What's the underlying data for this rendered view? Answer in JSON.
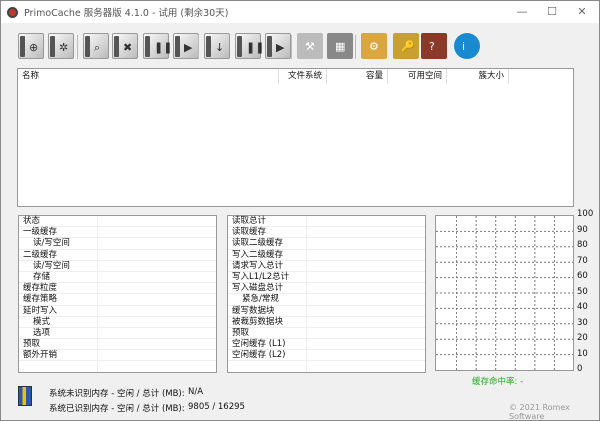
{
  "window": {
    "title": "PrimoCache 服务器版 4.1.0 - 试用 (剩余30天)",
    "minimize": "—",
    "maximize": "☐",
    "close": "✕"
  },
  "toolbar": [
    {
      "name": "new-cache-task",
      "glyph": "⊕"
    },
    {
      "name": "cache-options",
      "glyph": "✲"
    },
    {
      "name": "view-details",
      "glyph": "⌕"
    },
    {
      "name": "delete-task",
      "glyph": "✖"
    },
    {
      "name": "pause-task",
      "glyph": "❚❚"
    },
    {
      "name": "resume-task",
      "glyph": "▶"
    },
    {
      "name": "flush-deferred",
      "glyph": "↓"
    },
    {
      "name": "pause-deferred",
      "glyph": "❚❚"
    },
    {
      "name": "resume-deferred",
      "glyph": "▶"
    },
    {
      "name": "disk-tools",
      "glyph": "⚒"
    },
    {
      "name": "memory-tools",
      "glyph": "▦"
    },
    {
      "name": "settings",
      "glyph": "⚙"
    },
    {
      "name": "license",
      "glyph": "🔑"
    },
    {
      "name": "help",
      "glyph": "?"
    },
    {
      "name": "about",
      "glyph": "i"
    }
  ],
  "drive_list": {
    "columns": [
      "名称",
      "文件系统",
      "容量",
      "可用空间",
      "簇大小"
    ]
  },
  "status_table": [
    "状态",
    "一级缓存",
    "读/写空间",
    "二级缓存",
    "读/写空间",
    "存储",
    "缓存粒度",
    "缓存策略",
    "延时写入",
    "模式",
    "选项",
    "预取",
    "额外开销"
  ],
  "status_indent": [
    false,
    false,
    true,
    false,
    true,
    true,
    false,
    false,
    false,
    true,
    true,
    false,
    false
  ],
  "stats_table": [
    "读取总计",
    "读取缓存",
    "读取二级缓存",
    "写入二级缓存",
    "请求写入总计",
    "写入L1/L2总计",
    "写入磁盘总计",
    "紧急/常规",
    "缓写数据块",
    "被裁剪数据块",
    "预取",
    "空闲缓存 (L1)",
    "空闲缓存 (L2)"
  ],
  "stats_indent": [
    false,
    false,
    false,
    false,
    false,
    false,
    false,
    true,
    false,
    false,
    false,
    false,
    false
  ],
  "chart_data": {
    "type": "line",
    "title": "",
    "ylabel": "",
    "ylim": [
      0,
      100
    ],
    "yticks": [
      "100",
      "90",
      "80",
      "70",
      "60",
      "50",
      "40",
      "30",
      "20",
      "10",
      "0"
    ],
    "series": [
      {
        "name": "缓存命中率",
        "values": []
      }
    ],
    "legend": "缓存命中率: -",
    "grid": true,
    "color": "#22aa22"
  },
  "memory": {
    "unidentified_label": "系统未识别内存 - 空闲 / 总计 (MB):",
    "unidentified_value": "N/A",
    "identified_label": "系统已识别内存 - 空闲 / 总计 (MB):",
    "identified_value": "9805 / 16295"
  },
  "footer": {
    "copyright": "© 2021 Romex Software"
  }
}
